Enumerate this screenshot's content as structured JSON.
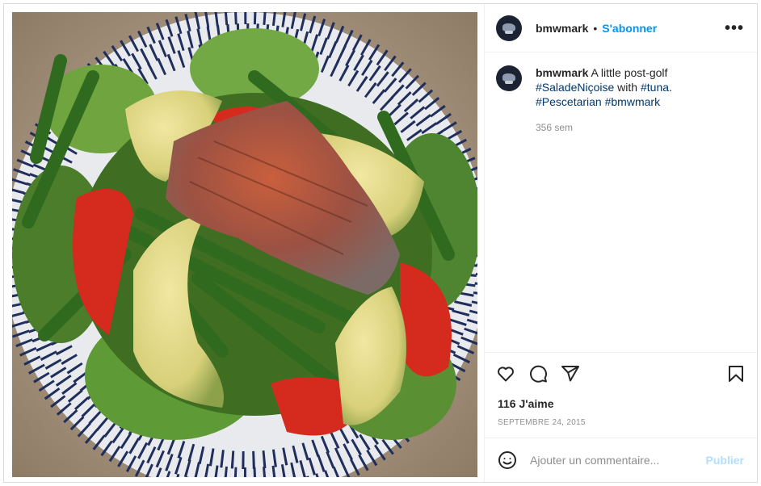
{
  "post": {
    "image_alt": "A little post-golf #SaladeNiçoise with #tuna."
  },
  "header": {
    "username": "bmwmark",
    "separator": "•",
    "follow_label": "S'abonner",
    "more_icon": "more-horizontal-icon",
    "more_glyph": "•••"
  },
  "caption": {
    "username": "bmwmark",
    "text_1": " A little post-golf ",
    "tag_1": "#SaladeNiçoise",
    "text_2": " with ",
    "tag_2": "#tuna",
    "text_3": ". ",
    "tag_3": "#Pescetarian",
    "text_4": " ",
    "tag_4": "#bmwmark",
    "time_ago": "356 sem"
  },
  "actions": {
    "like_icon": "heart-icon",
    "comment_icon": "comment-icon",
    "share_icon": "send-icon",
    "save_icon": "bookmark-icon"
  },
  "stats": {
    "likes": "116 J'aime",
    "date": "SEPTEMBRE 24, 2015"
  },
  "comment": {
    "emoji_icon": "emoji-icon",
    "placeholder": "Ajouter un commentaire...",
    "publish_label": "Publier",
    "publish_color": "#b2dffc"
  },
  "colors": {
    "link": "#0095f6",
    "hashtag": "#00376b",
    "muted": "#8e8e8e",
    "border": "#dbdbdb"
  }
}
